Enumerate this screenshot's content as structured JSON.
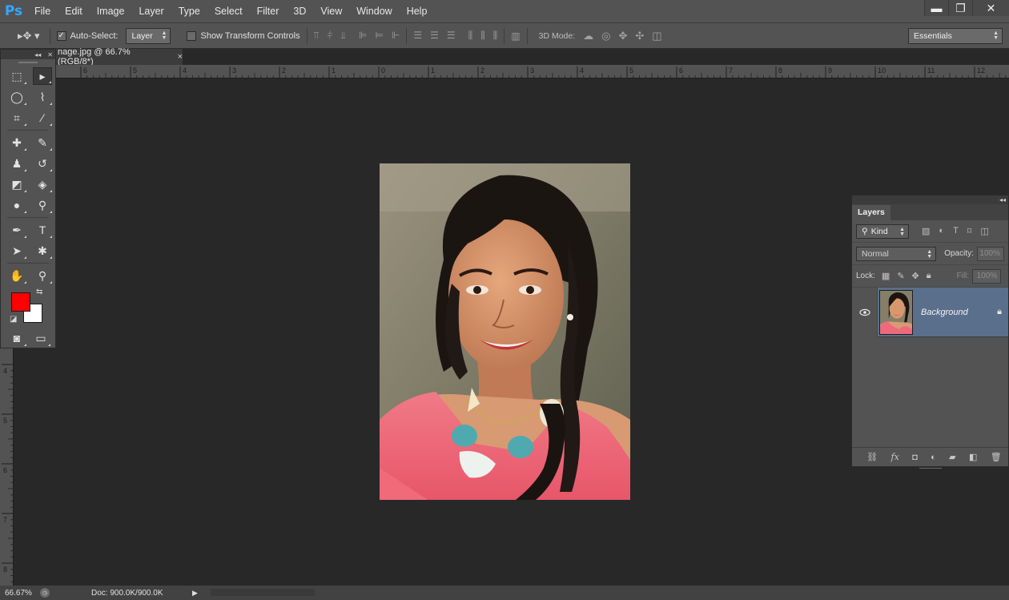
{
  "app": {
    "logo": "Ps"
  },
  "menu": [
    "File",
    "Edit",
    "Image",
    "Layer",
    "Type",
    "Select",
    "Filter",
    "3D",
    "View",
    "Window",
    "Help"
  ],
  "window_controls": {
    "minimize": "▬",
    "restore": "❐",
    "close": "✕"
  },
  "options": {
    "auto_select_label": "Auto-Select:",
    "auto_select_checked": true,
    "auto_select_target": "Layer",
    "show_transform_label": "Show Transform Controls",
    "show_transform_checked": false,
    "three_d_mode_label": "3D Mode:",
    "workspace": "Essentials"
  },
  "document_tab": {
    "title": "nage.jpg @ 66.7% (RGB/8*)",
    "close": "×"
  },
  "rulers": {
    "horizontal_ticks": [
      "6",
      "5",
      "4",
      "3",
      "2",
      "1",
      "0",
      "1",
      "2",
      "3",
      "4",
      "5",
      "6",
      "7",
      "8",
      "9",
      "10",
      "11",
      "12"
    ],
    "vertical_ticks": [
      "4",
      "5",
      "6",
      "7",
      "8"
    ]
  },
  "tools": {
    "foreground_color": "#ff0000",
    "background_color": "#ffffff",
    "icons": {
      "marquee": "⬚",
      "move": "▸",
      "lasso": "◯",
      "quick_select": "⌇",
      "crop": "⌗",
      "eyedropper": "⁄",
      "healing": "✚",
      "brush": "✎",
      "stamp": "♟",
      "history_brush": "↺",
      "eraser": "◩",
      "bucket": "◈",
      "blur": "●",
      "dodge": "⚲",
      "pen": "✒",
      "type": "T",
      "path_select": "➤",
      "shape": "✱",
      "hand": "✋",
      "zoom": "⚲",
      "quick_mask": "◙",
      "screen_mode": "▭"
    }
  },
  "layers_panel": {
    "tab_title": "Layers",
    "filter_kind": "Kind",
    "blend_mode": "Normal",
    "opacity_label": "Opacity:",
    "opacity_value": "100%",
    "lock_label": "Lock:",
    "fill_label": "Fill:",
    "fill_value": "100%",
    "layers": [
      {
        "name": "Background",
        "visible": true,
        "locked": true
      }
    ],
    "footer_icons": [
      "link-icon",
      "fx-icon",
      "mask-icon",
      "adjustment-icon",
      "folder-icon",
      "new-layer-icon",
      "trash-icon"
    ],
    "footer_glyphs": {
      "link": "⛓",
      "fx": "fx",
      "mask": "◘",
      "adjust": "◐",
      "folder": "▰",
      "new": "◧",
      "trash": "🗑"
    }
  },
  "status": {
    "zoom": "66.67%",
    "doc_size": "Doc: 900.0K/900.0K",
    "arrow": "▶"
  }
}
